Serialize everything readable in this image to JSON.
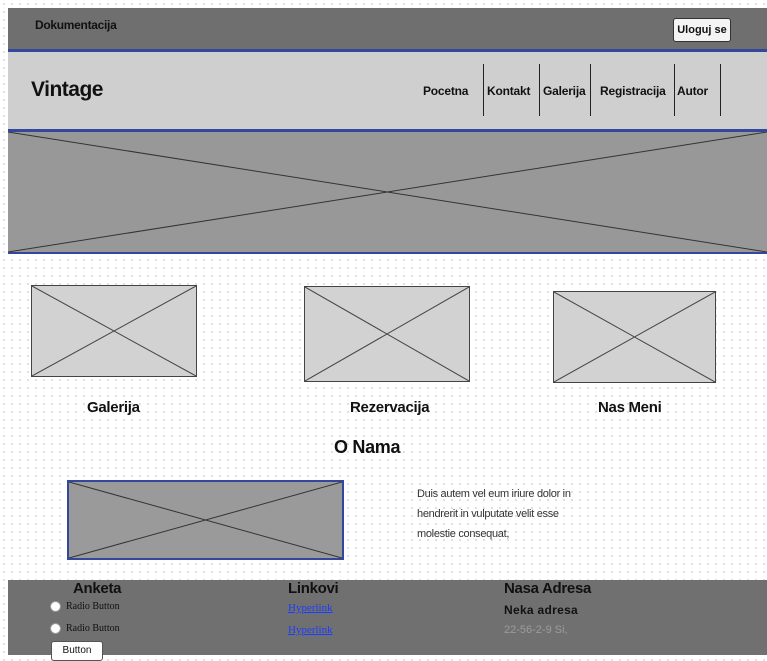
{
  "topbar": {
    "doc_label": "Dokumentacija",
    "login_label": "Uloguj se"
  },
  "header": {
    "brand": "Vintage",
    "nav": [
      "Pocetna",
      "Kontakt",
      "Galerija",
      "Registracija",
      "Autor"
    ]
  },
  "cards": [
    {
      "label": "Galerija",
      "image_icon": "image-placeholder-icon"
    },
    {
      "label": "Rezervacija",
      "image_icon": "image-placeholder-icon"
    },
    {
      "label": "Nas Meni",
      "image_icon": "image-placeholder-icon"
    }
  ],
  "about": {
    "title": "O Nama",
    "lines": [
      "Duis autem vel eum iriure dolor in",
      "hendrerit in vulputate velit esse",
      "molestie consequat,"
    ]
  },
  "footer": {
    "poll": {
      "title": "Anketa",
      "options": [
        "Radio Button",
        "Radio Button"
      ],
      "button_label": "Button"
    },
    "links": {
      "title": "Linkovi",
      "items": [
        "Hyperlink",
        "Hyperlink"
      ]
    },
    "address": {
      "title": "Nasa Adresa",
      "line1": "Neka adresa",
      "line2": "22-56-2-9 Si,"
    }
  },
  "colors": {
    "accent": "#33489b",
    "topbar": "#6f6f6f",
    "header": "#cfcfcf",
    "hero": "#989898",
    "link": "#1a3cff"
  }
}
